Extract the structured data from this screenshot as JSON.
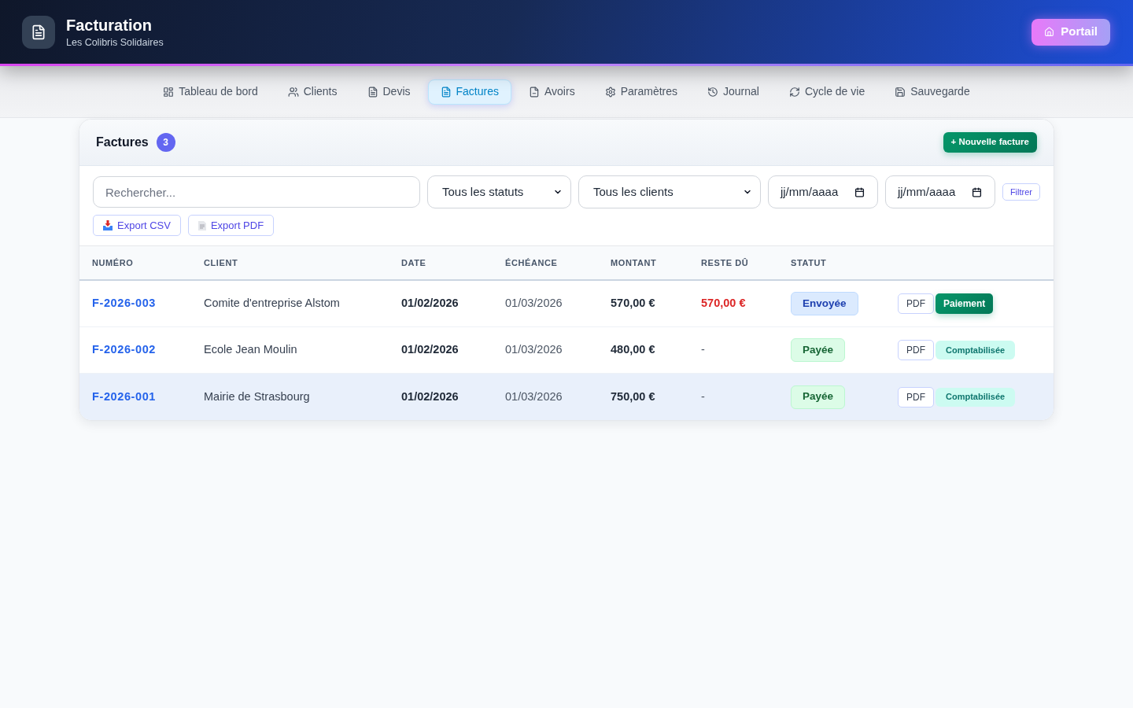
{
  "header": {
    "title": "Facturation",
    "subtitle": "Les Colibris Solidaires",
    "portal_button": "Portail"
  },
  "nav": [
    {
      "label": "Tableau de bord",
      "selected": false
    },
    {
      "label": "Clients",
      "selected": false
    },
    {
      "label": "Devis",
      "selected": false
    },
    {
      "label": "Factures",
      "selected": true
    },
    {
      "label": "Avoirs",
      "selected": false
    },
    {
      "label": "Paramètres",
      "selected": false
    },
    {
      "label": "Journal",
      "selected": false
    },
    {
      "label": "Cycle de vie",
      "selected": false
    },
    {
      "label": "Sauvegarde",
      "selected": false
    }
  ],
  "card": {
    "title": "Factures",
    "count": "3",
    "new_button": "+ Nouvelle facture"
  },
  "filters": {
    "search": {
      "placeholder": "Rechercher..."
    },
    "status_select": "Tous les statuts",
    "client_select": "Tous les clients",
    "date_from": {
      "placeholder": "jj/mm/aaaa"
    },
    "date_to": {
      "placeholder": "jj/mm/aaaa"
    },
    "filter_button": "Filtrer",
    "exports": [
      {
        "label": "Export CSV",
        "kind": "csv"
      },
      {
        "label": "Export PDF",
        "kind": "pdf"
      }
    ]
  },
  "table": {
    "columns": [
      "NUMÉRO",
      "CLIENT",
      "DATE",
      "ÉCHÉANCE",
      "MONTANT",
      "RESTE DÛ",
      "STATUT"
    ],
    "rows": [
      {
        "number": "F-2026-003",
        "client": "Comite d'entreprise Alstom",
        "date": "01/02/2026",
        "due_date": "01/03/2026",
        "amount": "570,00 €",
        "balance": "570,00 €",
        "outstanding": true,
        "status": {
          "label": "Envoyée",
          "kind": "sent"
        },
        "actions": [
          {
            "label": "PDF",
            "kind": "pdf"
          },
          {
            "label": "Paiement",
            "kind": "payment"
          }
        ],
        "selected": false
      },
      {
        "number": "F-2026-002",
        "client": "Ecole Jean Moulin",
        "date": "01/02/2026",
        "due_date": "01/03/2026",
        "amount": "480,00 €",
        "balance": "-",
        "outstanding": false,
        "status": {
          "label": "Payée",
          "kind": "paid"
        },
        "actions": [
          {
            "label": "PDF",
            "kind": "pdf"
          },
          {
            "label": "Comptabilisée",
            "kind": "posted"
          }
        ],
        "selected": false
      },
      {
        "number": "F-2026-001",
        "client": "Mairie de Strasbourg",
        "date": "01/02/2026",
        "due_date": "01/03/2026",
        "amount": "750,00 €",
        "balance": "-",
        "outstanding": false,
        "status": {
          "label": "Payée",
          "kind": "paid"
        },
        "actions": [
          {
            "label": "PDF",
            "kind": "pdf"
          },
          {
            "label": "Comptabilisée",
            "kind": "posted"
          }
        ],
        "selected": true
      }
    ]
  }
}
